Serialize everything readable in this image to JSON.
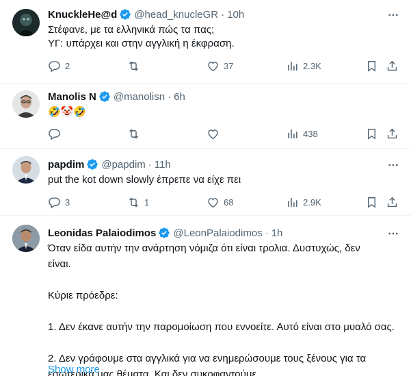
{
  "tweets": [
    {
      "name": "KnuckleHe@d",
      "handle": "@head_knucleGR",
      "time": "10h",
      "lines": [
        "Στέφανε, με τα ελληνικά πώς τα πας;",
        "ΥΓ: υπάρχει και στην αγγλική η έκφραση."
      ],
      "replies": "2",
      "retweets": "",
      "likes": "37",
      "views": "2.3K"
    },
    {
      "name": "Manolis N",
      "handle": "@manolisn",
      "time": "6h",
      "lines": [
        "🤣🤡🤣"
      ],
      "replies": "",
      "retweets": "",
      "likes": "",
      "views": "438"
    },
    {
      "name": "papdim",
      "handle": "@papdim",
      "time": "11h",
      "lines": [
        "put the kot down slowly έπρεπε να είχε πει"
      ],
      "replies": "3",
      "retweets": "1",
      "likes": "68",
      "views": "2.9K"
    },
    {
      "name": "Leonidas Palaiodimos",
      "handle": "@LeonPalaiodimos",
      "time": "1h",
      "lines": [
        "Όταν είδα αυτήν την ανάρτηση νόμιζα ότι είναι τρολια. Δυστυχώς, δεν",
        "είναι.",
        "",
        "Κύριε πρόεδρε:",
        "",
        "1. Δεν έκανε αυτήν την παρομοίωση που εννοείτε. Αυτό είναι στο μυαλό σας.",
        "",
        "2. Δεν γράφουμε στα αγγλικά για να ενημερώσουμε τους ξένους για τα",
        "εσωτερικά μας θέματα. Και δεν συκοφαντούμε..."
      ],
      "show_more": "Show more"
    }
  ],
  "icons": {
    "verified": "verified-badge-icon",
    "more": "more-dots-icon",
    "reply": "reply-icon",
    "retweet": "retweet-icon",
    "like": "like-icon",
    "views": "views-icon",
    "bookmark": "bookmark-icon",
    "share": "share-icon"
  },
  "colors": {
    "text": "#0f1419",
    "secondary": "#536471",
    "verified": "#1d9bf0",
    "link": "#1d9bf0",
    "divider": "#eff3f4"
  }
}
